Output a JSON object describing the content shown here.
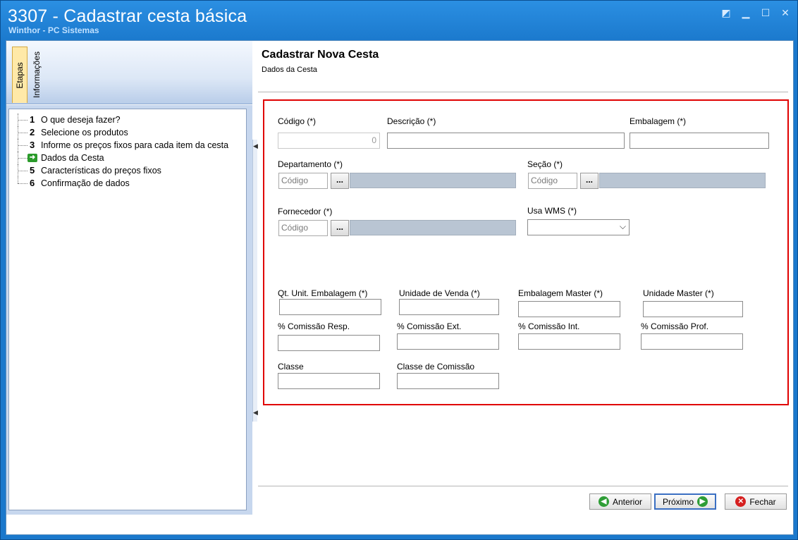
{
  "window": {
    "title": "3307 - Cadastrar cesta básica",
    "subtitle": "Winthor - PC Sistemas",
    "controls": [
      "restore-down",
      "minimize",
      "maximize",
      "close"
    ]
  },
  "sidebar": {
    "tabs": [
      {
        "label": "Etapas",
        "active": true
      },
      {
        "label": "Informações",
        "active": false
      }
    ],
    "steps": [
      {
        "num": "1",
        "label": "O que deseja fazer?"
      },
      {
        "num": "2",
        "label": "Selecione os produtos"
      },
      {
        "num": "3",
        "label": "Informe os preços fixos para cada item da cesta"
      },
      {
        "num": "",
        "label": "Dados da Cesta",
        "current": true
      },
      {
        "num": "5",
        "label": "Características do preços fixos"
      },
      {
        "num": "6",
        "label": "Confirmação de dados"
      }
    ]
  },
  "header": {
    "title": "Cadastrar Nova Cesta",
    "subtitle": "Dados da Cesta"
  },
  "form": {
    "codigo_label": "Código (*)",
    "codigo_value": "0",
    "descricao_label": "Descrição (*)",
    "embalagem_label": "Embalagem (*)",
    "departamento_label": "Departamento (*)",
    "departamento_code": "Código",
    "secao_label": "Seção (*)",
    "secao_code": "Código",
    "fornecedor_label": "Fornecedor (*)",
    "fornecedor_code": "Código",
    "usa_wms_label": "Usa WMS (*)",
    "qt_unit_label": "Qt. Unit. Embalagem (*)",
    "unidade_venda_label": "Unidade de Venda (*)",
    "embalagem_master_label": "Embalagem Master (*)",
    "unidade_master_label": "Unidade Master (*)",
    "comissao_resp_label": "% Comissão Resp.",
    "comissao_ext_label": "% Comissão Ext.",
    "comissao_int_label": "% Comissão Int.",
    "comissao_prof_label": "% Comissão Prof.",
    "classe_label": "Classe",
    "classe_comissao_label": "Classe de Comissão",
    "lookup_button": "..."
  },
  "footer": {
    "anterior": "Anterior",
    "proximo": "Próximo",
    "fechar": "Fechar"
  },
  "colors": {
    "highlight_frame": "#e00000",
    "titlebar": "#1a78cc"
  }
}
